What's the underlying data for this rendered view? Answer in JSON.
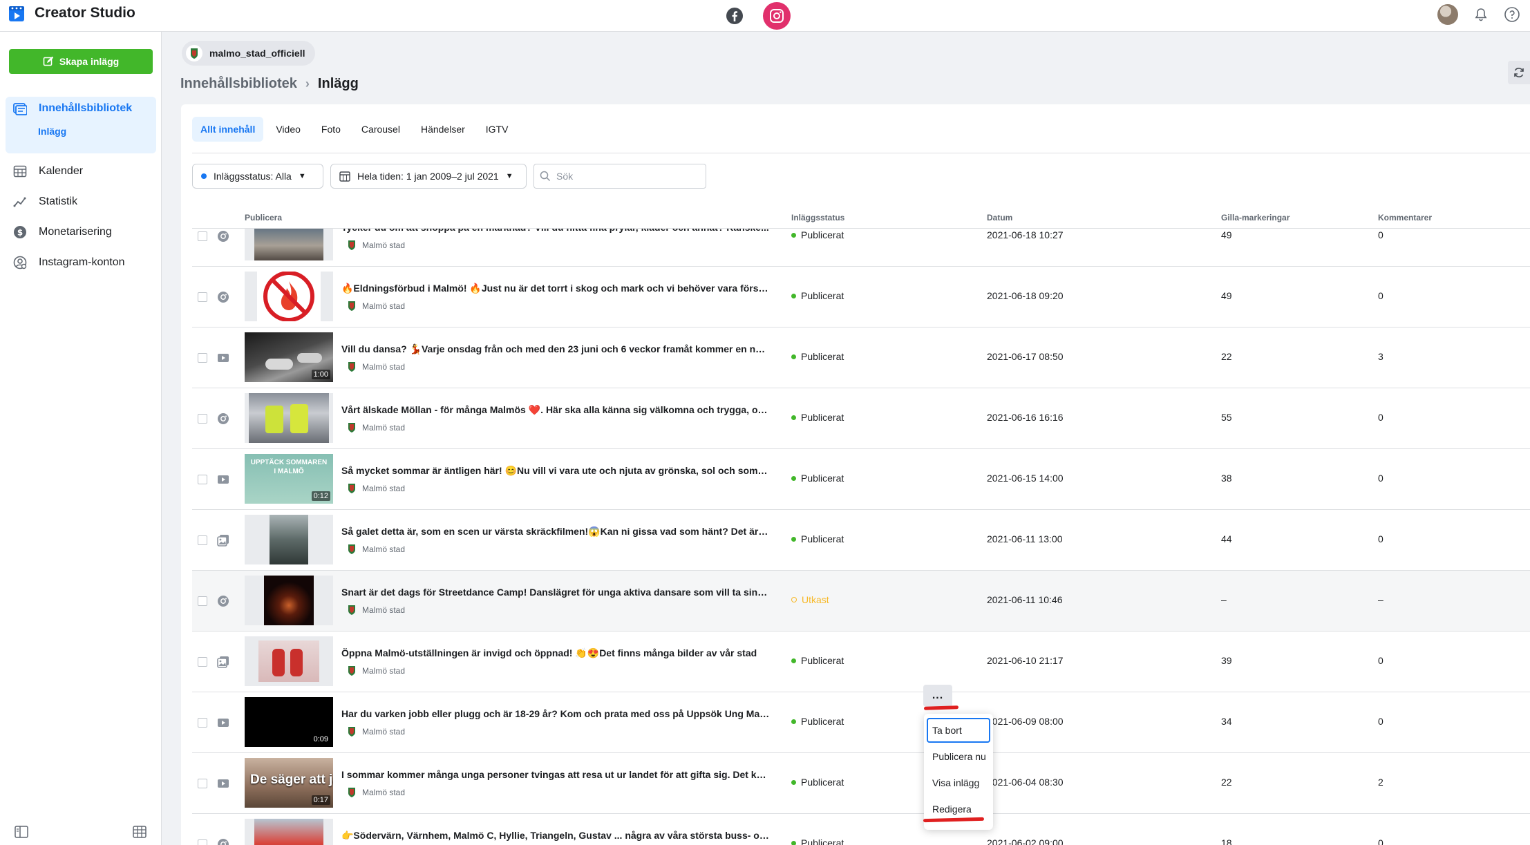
{
  "app": {
    "title": "Creator Studio"
  },
  "topbar": {
    "platforms": [
      "facebook-icon",
      "instagram-icon"
    ],
    "icons": [
      "avatar",
      "bell-icon",
      "help-icon"
    ]
  },
  "sidebar": {
    "create_label": "Skapa inlägg",
    "items": [
      {
        "label": "Innehållsbibliotek",
        "icon": "library-icon",
        "active": true
      },
      {
        "label": "Kalender",
        "icon": "calendar-icon"
      },
      {
        "label": "Statistik",
        "icon": "insights-icon"
      },
      {
        "label": "Monetarisering",
        "icon": "dollar-icon"
      },
      {
        "label": "Instagram-konton",
        "icon": "accounts-icon"
      }
    ],
    "sub_item": "Inlägg"
  },
  "account": {
    "name": "malmo_stad_officiell"
  },
  "breadcrumb": {
    "root": "Innehållsbibliotek",
    "current": "Inlägg"
  },
  "tabs": [
    "Allt innehåll",
    "Video",
    "Foto",
    "Carousel",
    "Händelser",
    "IGTV"
  ],
  "filters": {
    "status": "Inläggsstatus: Alla",
    "date": "Hela tiden: 1 jan 2009–2 jul 2021",
    "search_placeholder": "Sök"
  },
  "columns": {
    "publish": "Publicera",
    "status": "Inläggsstatus",
    "date": "Datum",
    "likes": "Gilla-markeringar",
    "comments": "Kommentarer"
  },
  "rows": [
    {
      "caption": "Tycker du om att shoppa på en marknad? Vill du hitta fina prylar, kläder och annat? Kanske...",
      "author": "Malmö stad",
      "status": "Publicerat",
      "date": "2021-06-18 10:27",
      "likes": "49",
      "comments": "0",
      "type": "photo",
      "thumb": "market"
    },
    {
      "caption": "🔥Eldningsförbud i Malmö! 🔥Just nu är det torrt i skog och mark och vi behöver vara försiktiga med elden",
      "author": "Malmö stad",
      "status": "Publicerat",
      "date": "2021-06-18 09:20",
      "likes": "49",
      "comments": "0",
      "type": "photo",
      "thumb": "nofire"
    },
    {
      "caption": "Vill du dansa? 💃Varje onsdag från och med den 23 juni och 6 veckor framåt kommer en ny danskurs",
      "author": "Malmö stad",
      "status": "Publicerat",
      "date": "2021-06-17 08:50",
      "likes": "22",
      "comments": "3",
      "type": "video",
      "thumb": "shoes",
      "duration": "1:00"
    },
    {
      "caption": "Vårt älskade Möllan - för många Malmös ❤️. Här ska alla känna sig välkomna och trygga, oavsett vem du är",
      "author": "Malmö stad",
      "status": "Publicerat",
      "date": "2021-06-16 16:16",
      "likes": "55",
      "comments": "0",
      "type": "photo",
      "thumb": "guards"
    },
    {
      "caption": "Så mycket sommar är äntligen här! 😊Nu vill vi vara ute och njuta av grönska, sol och sommarregn",
      "author": "Malmö stad",
      "status": "Publicerat",
      "date": "2021-06-15 14:00",
      "likes": "38",
      "comments": "0",
      "type": "video",
      "thumb": "summer",
      "duration": "0:12",
      "overlay": "UPPTÄCK SOMMAREN I MALMÖ"
    },
    {
      "caption": "Så galet detta är, som en scen ur värsta skräckfilmen!😱Kan ni gissa vad som hänt? Det är larver",
      "author": "Malmö stad",
      "status": "Publicerat",
      "date": "2021-06-11 13:00",
      "likes": "44",
      "comments": "0",
      "type": "carousel",
      "thumb": "forest"
    },
    {
      "caption": "Snart är det dags för Streetdance Camp! Danslägret för unga aktiva dansare som vill ta sin dans",
      "author": "Malmö stad",
      "status": "Utkast",
      "date": "2021-06-11 10:46",
      "likes": "–",
      "comments": "–",
      "type": "photo",
      "thumb": "dance",
      "draft": true
    },
    {
      "caption": "Öppna Malmö-utställningen är invigd och öppnad! 👏😍Det finns många bilder av vår stad",
      "author": "Malmö stad",
      "status": "Publicerat",
      "date": "2021-06-10 21:17",
      "likes": "39",
      "comments": "0",
      "type": "carousel",
      "thumb": "exhibit"
    },
    {
      "caption": "Har du varken jobb eller plugg och är 18-29 år? Kom och prata med oss på Uppsök Ung Malmö",
      "author": "Malmö stad",
      "status": "Publicerat",
      "date": "2021-06-09 08:00",
      "likes": "34",
      "comments": "0",
      "type": "video",
      "thumb": "black",
      "duration": "0:09"
    },
    {
      "caption": "I sommar kommer många unga personer tvingas att resa ut ur landet för att gifta sig. Det kallas för",
      "author": "Malmö stad",
      "status": "Publicerat",
      "date": "2021-06-04 08:30",
      "likes": "22",
      "comments": "2",
      "type": "video",
      "thumb": "face",
      "duration": "0:17",
      "overlay": "De säger att jag ska"
    },
    {
      "caption": "👉Södervärn, Värnhem, Malmö C, Hyllie, Triangeln, Gustav ... några av våra största buss- och tåg",
      "author": "Malmö stad",
      "status": "Publicerat",
      "date": "2021-06-02 09:00",
      "likes": "18",
      "comments": "0",
      "type": "photo",
      "thumb": "bus"
    }
  ],
  "row_menu": {
    "more_label": "...",
    "items": [
      "Ta bort",
      "Publicera nu",
      "Visa inlägg",
      "Redigera"
    ]
  },
  "colors": {
    "accent": "#1877f2",
    "create": "#42b72a",
    "published": "#42b72a",
    "draft": "#f7b928",
    "annotation": "#e02020"
  }
}
